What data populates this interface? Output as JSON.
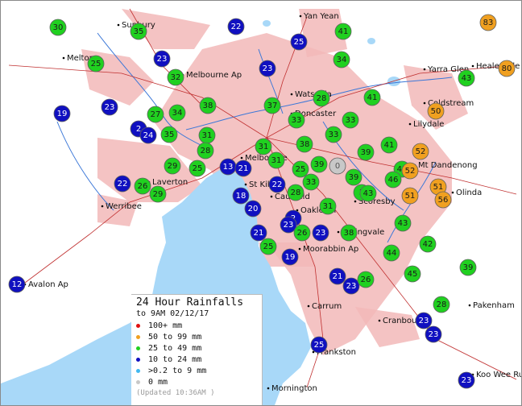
{
  "map": {
    "place_labels": [
      "Sunbury",
      "Yan Yean",
      "Yarra Glen",
      "Healesville",
      "Melton",
      "Melbourne Ap",
      "Watsonia",
      "Doncaster",
      "Coldstream",
      "Lilydale",
      "Melbourne",
      "Mt Dandenong",
      "Laverton",
      "St Kilda",
      "Caulfield",
      "Scoresby",
      "Olinda",
      "Werribee",
      "Oakleigh",
      "Springvale",
      "Moorabbin Ap",
      "Avalon Ap",
      "Carrum",
      "Pakenham",
      "Cranbourne",
      "Frankston",
      "Koo Wee Rup",
      "Mornington"
    ],
    "stations": [
      {
        "value": "30",
        "category": "25 to 49 mm"
      },
      {
        "value": "35",
        "category": "25 to 49 mm"
      },
      {
        "value": "22",
        "category": "10 to 24 mm"
      },
      {
        "value": "25",
        "category": "10 to 24 mm"
      },
      {
        "value": "41",
        "category": "25 to 49 mm"
      },
      {
        "value": "83",
        "category": "50 to 99 mm"
      },
      {
        "value": "25",
        "category": "25 to 49 mm"
      },
      {
        "value": "23",
        "category": "10 to 24 mm"
      },
      {
        "value": "32",
        "category": "25 to 49 mm"
      },
      {
        "value": "23",
        "category": "10 to 24 mm"
      },
      {
        "value": "34",
        "category": "25 to 49 mm"
      },
      {
        "value": "80",
        "category": "50 to 99 mm"
      },
      {
        "value": "43",
        "category": "25 to 49 mm"
      },
      {
        "value": "19",
        "category": "10 to 24 mm"
      },
      {
        "value": "23",
        "category": "10 to 24 mm"
      },
      {
        "value": "27",
        "category": "25 to 49 mm"
      },
      {
        "value": "34",
        "category": "25 to 49 mm"
      },
      {
        "value": "38",
        "category": "25 to 49 mm"
      },
      {
        "value": "37",
        "category": "25 to 49 mm"
      },
      {
        "value": "28",
        "category": "25 to 49 mm"
      },
      {
        "value": "41",
        "category": "25 to 49 mm"
      },
      {
        "value": "50",
        "category": "50 to 99 mm"
      },
      {
        "value": "2",
        "category": "10 to 24 mm"
      },
      {
        "value": "24",
        "category": "10 to 24 mm"
      },
      {
        "value": "35",
        "category": "25 to 49 mm"
      },
      {
        "value": "31",
        "category": "25 to 49 mm"
      },
      {
        "value": "33",
        "category": "25 to 49 mm"
      },
      {
        "value": "33",
        "category": "25 to 49 mm"
      },
      {
        "value": "33",
        "category": "25 to 49 mm"
      },
      {
        "value": "38",
        "category": "25 to 49 mm"
      },
      {
        "value": "31",
        "category": "25 to 49 mm"
      },
      {
        "value": "28",
        "category": "25 to 49 mm"
      },
      {
        "value": "39",
        "category": "25 to 49 mm"
      },
      {
        "value": "41",
        "category": "25 to 49 mm"
      },
      {
        "value": "52",
        "category": "50 to 99 mm"
      },
      {
        "value": "29",
        "category": "25 to 49 mm"
      },
      {
        "value": "25",
        "category": "25 to 49 mm"
      },
      {
        "value": "13",
        "category": "10 to 24 mm"
      },
      {
        "value": "21",
        "category": "10 to 24 mm"
      },
      {
        "value": "31",
        "category": "25 to 49 mm"
      },
      {
        "value": "25",
        "category": "25 to 49 mm"
      },
      {
        "value": "39",
        "category": "25 to 49 mm"
      },
      {
        "value": "0",
        "category": "0 mm"
      },
      {
        "value": "45",
        "category": "25 to 49 mm"
      },
      {
        "value": "52",
        "category": "50 to 99 mm"
      },
      {
        "value": "22",
        "category": "10 to 24 mm"
      },
      {
        "value": "26",
        "category": "25 to 49 mm"
      },
      {
        "value": "29",
        "category": "25 to 49 mm"
      },
      {
        "value": "22",
        "category": "10 to 24 mm"
      },
      {
        "value": "33",
        "category": "25 to 49 mm"
      },
      {
        "value": "39",
        "category": "25 to 49 mm"
      },
      {
        "value": "46",
        "category": "25 to 49 mm"
      },
      {
        "value": "51",
        "category": "50 to 99 mm"
      },
      {
        "value": "51",
        "category": "50 to 99 mm"
      },
      {
        "value": "18",
        "category": "10 to 24 mm"
      },
      {
        "value": "28",
        "category": "25 to 49 mm"
      },
      {
        "value": "3",
        "category": "25 to 49 mm"
      },
      {
        "value": "43",
        "category": "25 to 49 mm"
      },
      {
        "value": "56",
        "category": "50 to 99 mm"
      },
      {
        "value": "20",
        "category": "10 to 24 mm"
      },
      {
        "value": "31",
        "category": "25 to 49 mm"
      },
      {
        "value": "2",
        "category": "10 to 24 mm"
      },
      {
        "value": "43",
        "category": "25 to 49 mm"
      },
      {
        "value": "23",
        "category": "10 to 24 mm"
      },
      {
        "value": "21",
        "category": "10 to 24 mm"
      },
      {
        "value": "26",
        "category": "25 to 49 mm"
      },
      {
        "value": "23",
        "category": "10 to 24 mm"
      },
      {
        "value": "38",
        "category": "25 to 49 mm"
      },
      {
        "value": "42",
        "category": "25 to 49 mm"
      },
      {
        "value": "25",
        "category": "25 to 49 mm"
      },
      {
        "value": "19",
        "category": "10 to 24 mm"
      },
      {
        "value": "44",
        "category": "25 to 49 mm"
      },
      {
        "value": "39",
        "category": "25 to 49 mm"
      },
      {
        "value": "12",
        "category": "10 to 24 mm"
      },
      {
        "value": "21",
        "category": "10 to 24 mm"
      },
      {
        "value": "23",
        "category": "10 to 24 mm"
      },
      {
        "value": "26",
        "category": "25 to 49 mm"
      },
      {
        "value": "45",
        "category": "25 to 49 mm"
      },
      {
        "value": "28",
        "category": "25 to 49 mm"
      },
      {
        "value": "23",
        "category": "10 to 24 mm"
      },
      {
        "value": "23",
        "category": "10 to 24 mm"
      },
      {
        "value": "25",
        "category": "10 to 24 mm"
      },
      {
        "value": "23",
        "category": "10 to 24 mm"
      }
    ]
  },
  "legend": {
    "title": "24 Hour Rainfalls",
    "subtitle": "to 9AM 02/12/17",
    "items": [
      {
        "label": "100+ mm",
        "color": "#e01010"
      },
      {
        "label": "50  to 99 mm",
        "color": "#f0a020"
      },
      {
        "label": "25  to 49 mm",
        "color": "#20d020"
      },
      {
        "label": "10  to 24 mm",
        "color": "#1010c0"
      },
      {
        "label": ">0.2 to 9 mm",
        "color": "#40b8f0"
      },
      {
        "label": "0 mm",
        "color": "#c8c8c8"
      }
    ],
    "updated": "(Updated 10:36AM  )"
  },
  "colors": {
    "urban": "#f2b8b8",
    "water": "#a8d8f8",
    "road": "#c03030",
    "river": "#3c78d8",
    "marker_stroke": "#606060"
  }
}
